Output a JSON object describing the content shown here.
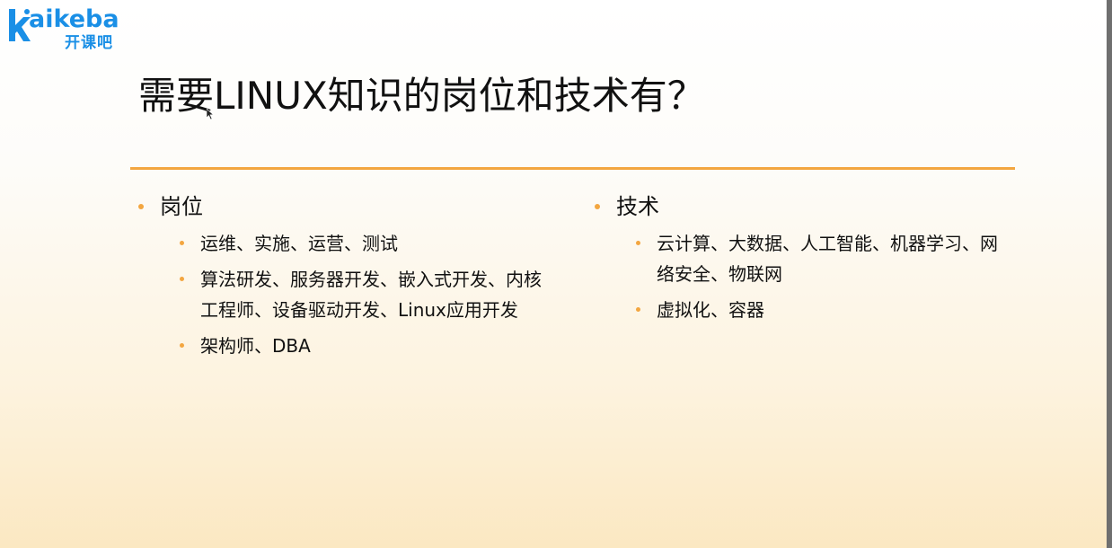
{
  "logo": {
    "word": "aikeba",
    "sub": "开课吧",
    "brand_color": "#1a8fe6"
  },
  "title": "需要LINUX知识的岗位和技术有？",
  "accent_color": "#f3a640",
  "sections": [
    {
      "heading": "岗位",
      "items": [
        "运维、实施、运营、测试",
        "算法研发、服务器开发、嵌入式开发、内核工程师、设备驱动开发、Linux应用开发",
        "架构师、DBA"
      ]
    },
    {
      "heading": "技术",
      "items": [
        "云计算、大数据、人工智能、机器学习、网络安全、物联网",
        "虚拟化、容器"
      ]
    }
  ]
}
